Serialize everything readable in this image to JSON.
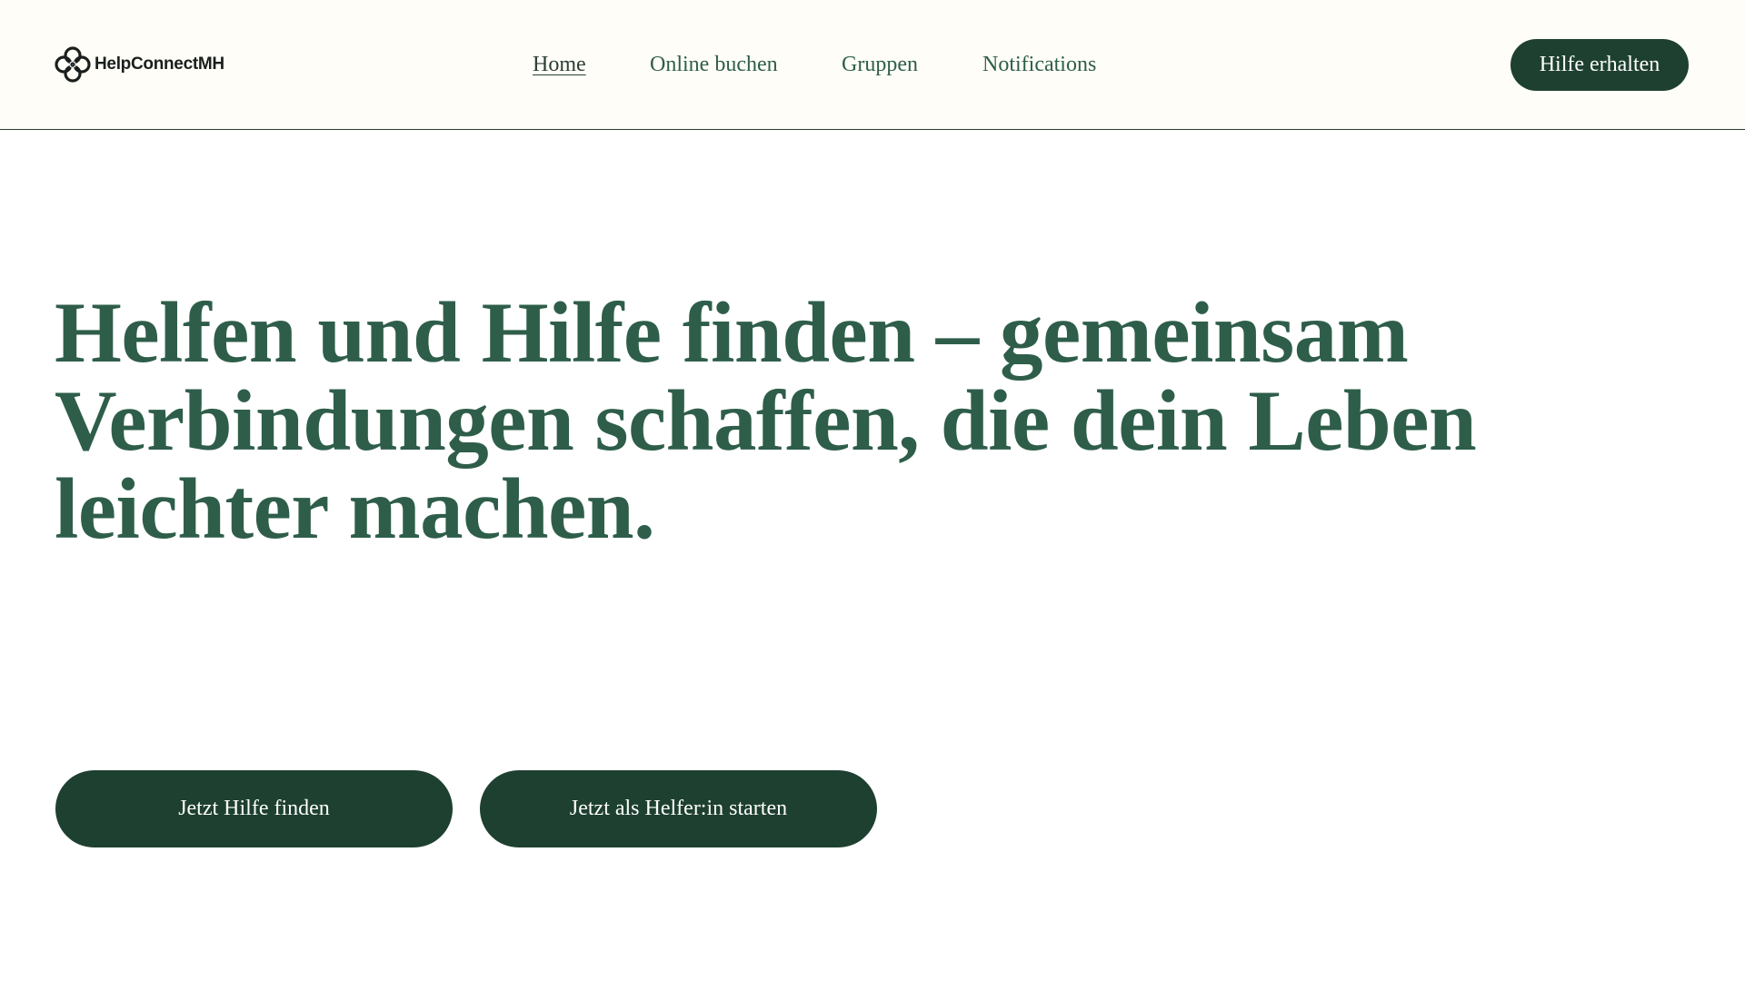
{
  "header": {
    "logo_text": "HelpConnectMH",
    "logo_icon": "interlocking-rings-logo",
    "nav": [
      {
        "label": "Home",
        "active": true
      },
      {
        "label": "Online buchen",
        "active": false
      },
      {
        "label": "Gruppen",
        "active": false
      },
      {
        "label": "Notifications",
        "active": false
      }
    ],
    "cta_label": "Hilfe erhalten"
  },
  "hero": {
    "title": "Helfen und Hilfe finden – gemeinsam Verbindungen schaffen, die dein Leben leichter machen.",
    "primary_cta": "Jetzt Hilfe finden",
    "secondary_cta": "Jetzt als Helfer:in starten"
  },
  "colors": {
    "header_bg": "#fefdf7",
    "brand_green": "#1e4030",
    "heading_green": "#2e5e4a",
    "page_bg": "#ffffff"
  }
}
